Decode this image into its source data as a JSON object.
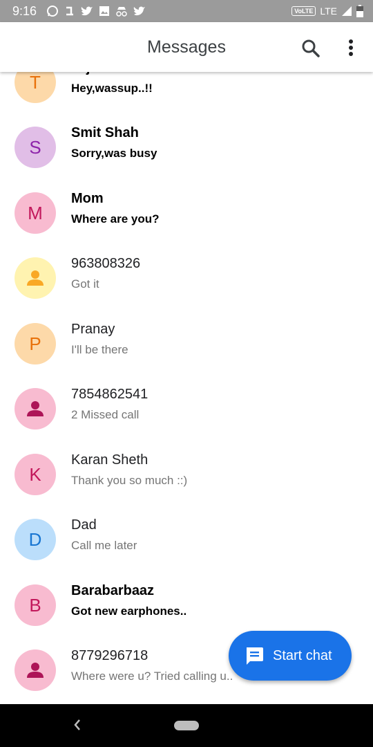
{
  "status_bar": {
    "time": "9:16",
    "volte": "VoLTE",
    "network": "LTE"
  },
  "app_bar": {
    "title": "Messages"
  },
  "conversations": [
    {
      "initial": "T",
      "name": "Tejas Trivedi",
      "snippet": "Hey,wassup..!!",
      "unread": true,
      "avatar_bg": "#fdd9a9",
      "avatar_fg": "#e8710a"
    },
    {
      "initial": "S",
      "name": "Smit Shah",
      "snippet": "Sorry,was busy",
      "unread": true,
      "avatar_bg": "#e1bee7",
      "avatar_fg": "#8e24aa"
    },
    {
      "initial": "M",
      "name": "Mom",
      "snippet": "Where are you?",
      "unread": true,
      "avatar_bg": "#f8bbd0",
      "avatar_fg": "#c2185b"
    },
    {
      "initial": "",
      "icon": "person-icon",
      "name": "963808326",
      "snippet": "Got it",
      "unread": false,
      "avatar_bg": "#fff3b0",
      "avatar_fg": "#f9a825"
    },
    {
      "initial": "P",
      "name": "Pranay",
      "snippet": "I'll be there",
      "unread": false,
      "avatar_bg": "#fdd9a9",
      "avatar_fg": "#e8710a"
    },
    {
      "initial": "",
      "icon": "person-icon",
      "name": "7854862541",
      "snippet": "2 Missed call",
      "unread": false,
      "avatar_bg": "#f8bbd0",
      "avatar_fg": "#ad1457"
    },
    {
      "initial": "K",
      "name": "Karan Sheth",
      "snippet": "Thank you so much ::)",
      "unread": false,
      "avatar_bg": "#f8bbd0",
      "avatar_fg": "#c2185b"
    },
    {
      "initial": "D",
      "name": "Dad",
      "snippet": "Call me later",
      "unread": false,
      "avatar_bg": "#bbdefb",
      "avatar_fg": "#1976d2"
    },
    {
      "initial": "B",
      "name": "Barabarbaaz",
      "snippet": "Got new earphones..",
      "unread": true,
      "avatar_bg": "#f8bbd0",
      "avatar_fg": "#c2185b"
    },
    {
      "initial": "",
      "icon": "person-icon",
      "name": "8779296718",
      "snippet": "Where were u? Tried calling u..",
      "unread": false,
      "avatar_bg": "#f8bbd0",
      "avatar_fg": "#ad1457"
    }
  ],
  "fab": {
    "label": "Start chat",
    "color": "#1a73e8"
  }
}
